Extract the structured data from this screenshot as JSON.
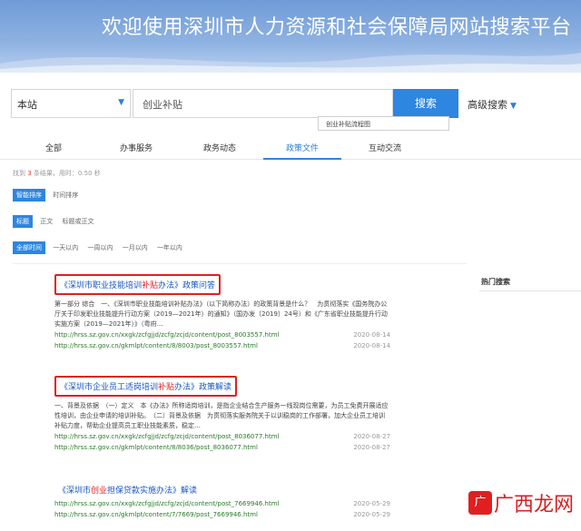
{
  "banner": {
    "title": "欢迎使用深圳市人力资源和社会保障局网站搜索平台"
  },
  "search": {
    "scope": "本站",
    "query": "创业补贴",
    "button": "搜索",
    "advanced": "高级搜索",
    "suggestion": "创业补贴流程图"
  },
  "tabs": [
    "全部",
    "办事服务",
    "政务动态",
    "政策文件",
    "互动交流"
  ],
  "result_count": {
    "prefix": "找到",
    "count": "3",
    "suffix": "条结果，用时：0.50 秒"
  },
  "filters": {
    "sort": {
      "active": "智能排序",
      "other": "时间排序"
    },
    "field": {
      "active": "标题",
      "opts": [
        "正文",
        "标题或正文"
      ]
    },
    "time": {
      "active": "全部时间",
      "opts": [
        "一天以内",
        "一周以内",
        "一月以内",
        "一年以内"
      ]
    }
  },
  "results": [
    {
      "title_pre": "《深圳市职业技能培训",
      "title_hl": "补贴",
      "title_post": "办法》政策问答",
      "snippet": "第一部分 综合　一、《深圳市职业技能培训补贴办法》（以下简称办法）的政策背景是什么？　为贯彻落实《国务院办公厅关于印发职业技能提升行动方案（2019—2021年）的通知》（国办发〔2019〕24号）和《广东省职业技能提升行动实施方案（2019—2021年）》（粤府…",
      "links": [
        {
          "url": "http://hrss.sz.gov.cn/xxgk/zcfgjjd/zcfg/zcjd/content/post_8003557.html",
          "date": "2020-08-14"
        },
        {
          "url": "http://hrss.sz.gov.cn/gkmlpt/content/8/8003/post_8003557.html",
          "date": "2020-08-14"
        }
      ]
    },
    {
      "title_pre": "《深圳市企业员工适岗培训",
      "title_hl": "补贴",
      "title_post": "办法》政策解读",
      "snippet": "一、背景及依据　（一）定义　本《办法》所称适岗培训，是指企业结合生产服务一线现岗位需要，为员工免费开展适应性培训，由企业申请的培训补贴。　（二）背景及依据　为贯彻落实服务院关于以训稳岗的工作部署，加大企业员工培训补贴力度，帮助企业提高员工职业技能素质，稳定…",
      "links": [
        {
          "url": "http://hrss.sz.gov.cn/xxgk/zcfgjjd/zcfg/zcjd/content/post_8036077.html",
          "date": "2020-08-27"
        },
        {
          "url": "http://hrss.sz.gov.cn/gkmlpt/content/8/8036/post_8036077.html",
          "date": "2020-08-27"
        }
      ]
    },
    {
      "title_pre": "《深圳市",
      "title_hl": "创业",
      "title_post": "担保贷款实施办法》解读",
      "links": [
        {
          "url": "http://hrss.sz.gov.cn/xxgk/zcfgjjd/zcfg/zcjd/content/post_7669946.html",
          "date": "2020-05-29"
        },
        {
          "url": "http://hrss.sz.gov.cn/gkmlpt/content/7/7669/post_7669946.html",
          "date": "2020-05-29"
        }
      ]
    }
  ],
  "sidebar": {
    "hot_search": "热门搜索"
  },
  "watermark": {
    "icon": "广",
    "text": "广西龙网"
  }
}
